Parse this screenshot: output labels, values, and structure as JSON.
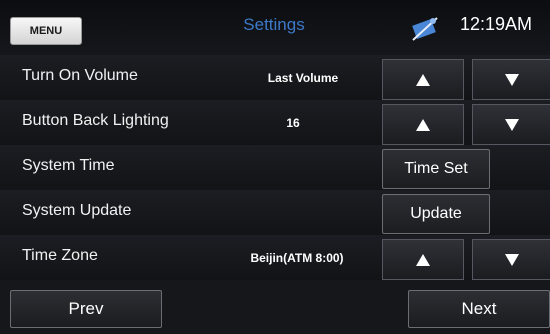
{
  "header": {
    "menu_label": "MENU",
    "title": "Settings",
    "time": "12:19AM",
    "status_icon": "satellite-icon"
  },
  "rows": [
    {
      "label": "Turn On Volume",
      "value": "Last Volume",
      "controls": "up-down"
    },
    {
      "label": "Button Back Lighting",
      "value": "16",
      "controls": "up-down"
    },
    {
      "label": "System Time",
      "value": "",
      "controls": "button",
      "button_label": "Time Set"
    },
    {
      "label": "System Update",
      "value": "",
      "controls": "button",
      "button_label": "Update"
    },
    {
      "label": "Time Zone",
      "value": "Beijin(ATM 8:00)",
      "controls": "up-down"
    }
  ],
  "footer": {
    "prev_label": "Prev",
    "next_label": "Next"
  },
  "colors": {
    "accent": "#3d79c9",
    "row_divider": "#3a6ca8",
    "background": "#16171b"
  }
}
